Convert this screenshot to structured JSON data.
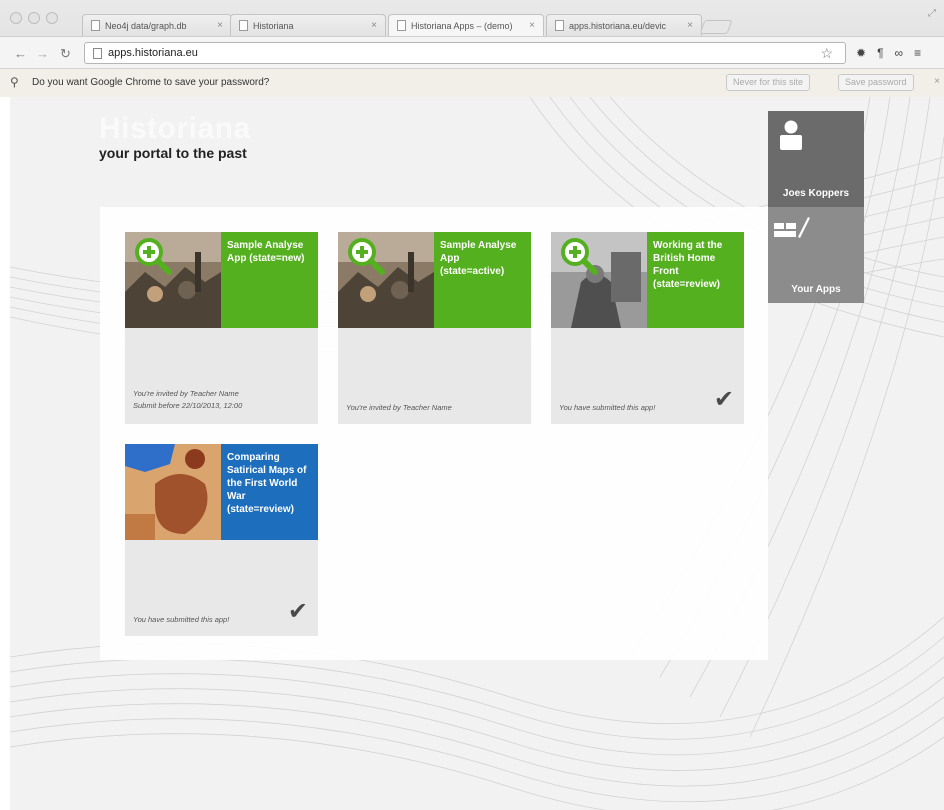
{
  "browser": {
    "tabs": [
      {
        "title": "Neo4j data/graph.db"
      },
      {
        "title": "Historiana"
      },
      {
        "title": "Historiana Apps – (demo)"
      },
      {
        "title": "apps.historiana.eu/devic"
      }
    ],
    "url": "apps.historiana.eu",
    "infobar": {
      "message": "Do you want Google Chrome to save your password?",
      "never_button": "Never for this site",
      "save_button": "Save password"
    }
  },
  "site": {
    "logo": "Historiana",
    "tagline": "your portal to the past"
  },
  "user_tile": {
    "label": "Joes Koppers"
  },
  "apps_tile": {
    "label": "Your Apps"
  },
  "colors": {
    "accent_green": "#55b020",
    "accent_blue": "#1d6fbe"
  },
  "cards": [
    {
      "title": "Sample Analyse App (state=new)",
      "info_line1": "You're invited by Teacher Name",
      "info_line2": "Submit before 22/10/2013, 12:00"
    },
    {
      "title": "Sample Analyse App (state=active)",
      "info_line1": "You're invited by Teacher Name"
    },
    {
      "title": "Working at the British Home Front (state=review)",
      "info_line1": "You have submitted this app!"
    },
    {
      "title": "Comparing Satirical Maps of the First World War (state=review)",
      "info_line1": "You have submitted this app!"
    }
  ]
}
